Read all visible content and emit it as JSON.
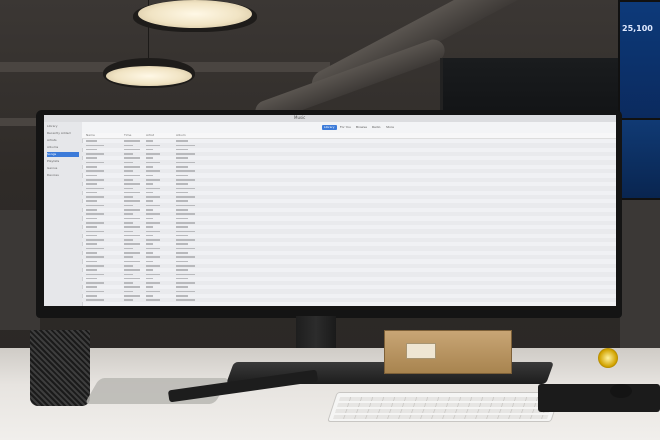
{
  "scene": {
    "tv_text": "25,100"
  },
  "app": {
    "window_title": "Music",
    "sidebar_items": [
      "Library",
      "Recently Added",
      "Artists",
      "Albums",
      "Songs",
      "Playlists",
      "Genius",
      "Devices"
    ],
    "selected_sidebar_index": 4,
    "tabs": [
      "Library",
      "For You",
      "Browse",
      "Radio",
      "Store"
    ],
    "active_tab_index": 0,
    "columns": [
      "Name",
      "Time",
      "Artist",
      "Album"
    ],
    "rows_note": ""
  },
  "colors": {
    "accent": "#3c7bd9",
    "screen_bg": "#f0f1f4"
  }
}
